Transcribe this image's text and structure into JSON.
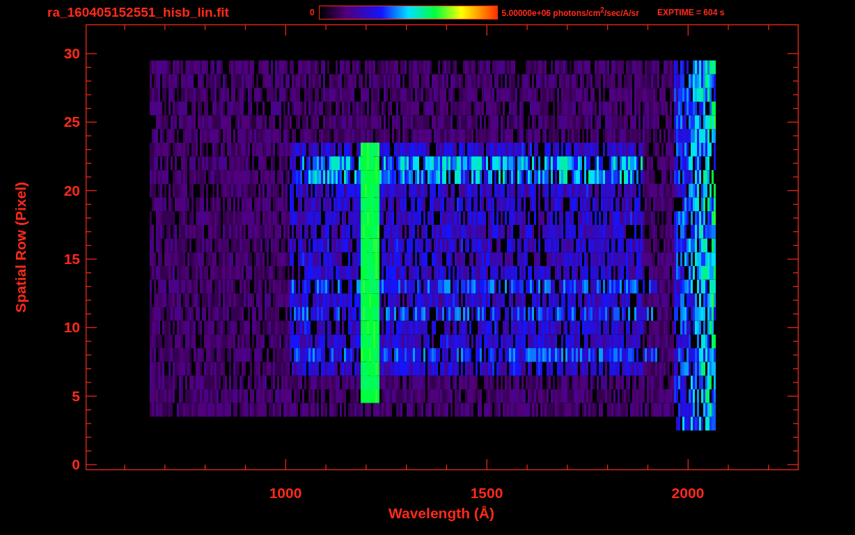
{
  "header": {
    "title": "ra_160405152551_hisb_lin.fit",
    "colorbar_min": "0",
    "colorbar_max": "5.00000e+06 photons/cm$^{2}$/sec/A/sr",
    "exposure": "EXPTIME = 604 s"
  },
  "plot": {
    "ylabel": "Spatial Row (Pixel)",
    "xlabel": "Wavelength (Å)",
    "yticks": [
      "30",
      "25",
      "20",
      "15",
      "10",
      "5",
      "0"
    ],
    "xticks": [
      "1000",
      "1500",
      "2000"
    ]
  }
}
